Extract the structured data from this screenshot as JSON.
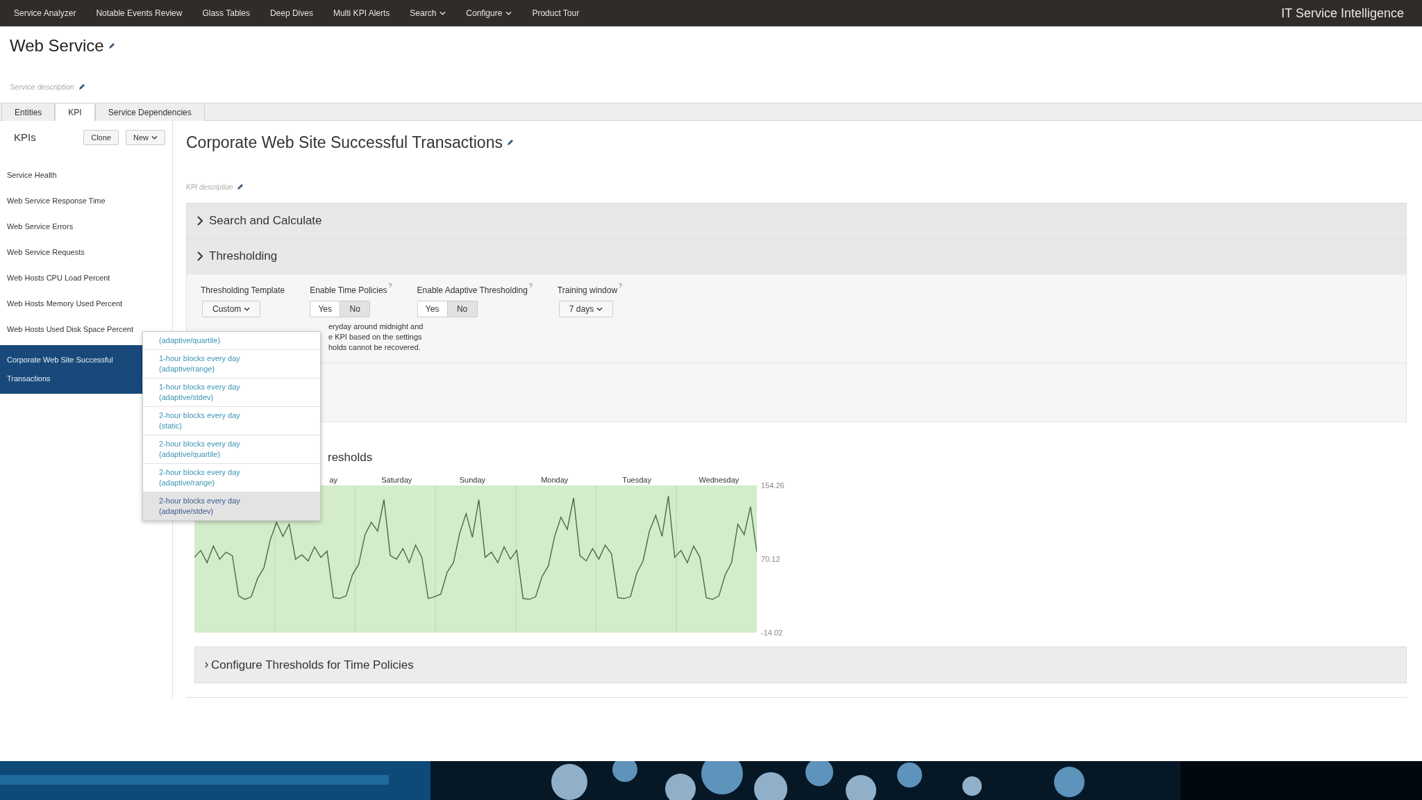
{
  "nav": {
    "items": [
      {
        "label": "Service Analyzer",
        "has_menu": false
      },
      {
        "label": "Notable Events Review",
        "has_menu": false
      },
      {
        "label": "Glass Tables",
        "has_menu": false
      },
      {
        "label": "Deep Dives",
        "has_menu": false
      },
      {
        "label": "Multi KPI Alerts",
        "has_menu": false
      },
      {
        "label": "Search",
        "has_menu": true
      },
      {
        "label": "Configure",
        "has_menu": true
      },
      {
        "label": "Product Tour",
        "has_menu": false
      }
    ],
    "app_name": "IT Service Intelligence"
  },
  "service": {
    "title": "Web Service",
    "description_placeholder": "Service description"
  },
  "tabs": [
    {
      "label": "Entities",
      "selected": false
    },
    {
      "label": "KPI",
      "selected": true
    },
    {
      "label": "Service Dependencies",
      "selected": false
    }
  ],
  "sidebar": {
    "title": "KPIs",
    "buttons": [
      {
        "label": "Clone",
        "has_menu": false
      },
      {
        "label": "New",
        "has_menu": true
      }
    ],
    "items": [
      {
        "label": "Service Health",
        "selected": false
      },
      {
        "label": "Web Service Response Time",
        "selected": false
      },
      {
        "label": "Web Service Errors",
        "selected": false
      },
      {
        "label": "Web Service Requests",
        "selected": false
      },
      {
        "label": "Web Hosts CPU Load Percent",
        "selected": false
      },
      {
        "label": "Web Hosts Memory Used Percent",
        "selected": false
      },
      {
        "label": "Web Hosts Used Disk Space Percent",
        "selected": false
      },
      {
        "label": "Corporate Web Site Successful Transactions",
        "selected": true
      }
    ]
  },
  "kpi": {
    "title": "Corporate Web Site Successful Transactions",
    "description_placeholder": "KPI description"
  },
  "sections": [
    {
      "label": "Search and Calculate",
      "expanded": false
    },
    {
      "label": "Thresholding",
      "expanded": false
    }
  ],
  "thresholding": {
    "fields": [
      {
        "kind": "dropdown",
        "label": "Thresholding Template",
        "value": "Custom"
      },
      {
        "kind": "toggle",
        "label": "Enable Time Policies",
        "help": "?",
        "options": [
          {
            "label": "Yes",
            "selected": false
          },
          {
            "label": "No",
            "selected": true
          }
        ]
      },
      {
        "kind": "toggle",
        "label": "Enable Adaptive Thresholding",
        "help": "?",
        "options": [
          {
            "label": "Yes",
            "selected": false
          },
          {
            "label": "No",
            "selected": true
          }
        ]
      },
      {
        "kind": "dropdown",
        "label": "Training window",
        "help": "?",
        "value": "7 days"
      }
    ],
    "note_lines": [
      "eryday around midnight and",
      "e KPI based on the settings",
      "holds cannot be recovered."
    ]
  },
  "template_menu": {
    "items": [
      {
        "label": "(adaptive/quartile)",
        "selected": false
      },
      {
        "label": "1-hour blocks every day (adaptive/range)",
        "selected": false
      },
      {
        "label": "1-hour blocks every day (adaptive/stdev)",
        "selected": false
      },
      {
        "label": "2-hour blocks every day (static)",
        "selected": false
      },
      {
        "label": "2-hour blocks every day (adaptive/quartile)",
        "selected": false
      },
      {
        "label": "2-hour blocks every day (adaptive/range)",
        "selected": false
      },
      {
        "label": "2-hour blocks every day (adaptive/stdev)",
        "selected": true
      }
    ]
  },
  "preview": {
    "heading": "resholds",
    "chart_data": {
      "type": "line",
      "categories": [
        null,
        null,
        null,
        null,
        null,
        null,
        null,
        null,
        null,
        null,
        null,
        null,
        null,
        null,
        null,
        null,
        null,
        null,
        null,
        null,
        null,
        null,
        "ay",
        null,
        null,
        null,
        null,
        null,
        null,
        null,
        null,
        null,
        "Saturday",
        null,
        null,
        null,
        null,
        null,
        null,
        null,
        null,
        null,
        null,
        null,
        "Sunday",
        null,
        null,
        null,
        null,
        null,
        null,
        null,
        null,
        null,
        null,
        null,
        null,
        "Monday",
        null,
        null,
        null,
        null,
        null,
        null,
        null,
        null,
        null,
        null,
        null,
        null,
        "Tuesday",
        null,
        null,
        null,
        null,
        null,
        null,
        null,
        null,
        null,
        null,
        null,
        null,
        "Wednesday",
        null,
        null,
        null,
        null,
        null,
        null
      ],
      "yticks": [
        {
          "value": 154.26,
          "label": "154.26"
        },
        {
          "value": 70.12,
          "label": "70.12"
        },
        {
          "value": -14.02,
          "label": "-14.02"
        }
      ],
      "ylim": [
        -14.02,
        154.26
      ],
      "series": [
        {
          "color": "#4a6b45",
          "values": [
            72,
            80,
            66,
            85,
            70,
            78,
            74,
            28,
            24,
            27,
            48,
            60,
            92,
            112,
            96,
            110,
            70,
            75,
            68,
            84,
            72,
            79,
            26,
            25,
            28,
            52,
            64,
            98,
            112,
            102,
            138,
            74,
            70,
            82,
            66,
            86,
            72,
            25,
            27,
            30,
            55,
            66,
            100,
            122,
            95,
            138,
            72,
            78,
            66,
            84,
            70,
            80,
            25,
            24,
            27,
            50,
            62,
            96,
            118,
            104,
            140,
            74,
            68,
            82,
            70,
            86,
            76,
            26,
            25,
            27,
            54,
            68,
            102,
            120,
            96,
            142,
            72,
            80,
            66,
            85,
            72,
            26,
            24,
            28,
            52,
            66,
            110,
            98,
            130,
            78
          ]
        }
      ]
    }
  },
  "time_policies": {
    "label": "Configure Thresholds for Time Policies",
    "expanded": false
  }
}
